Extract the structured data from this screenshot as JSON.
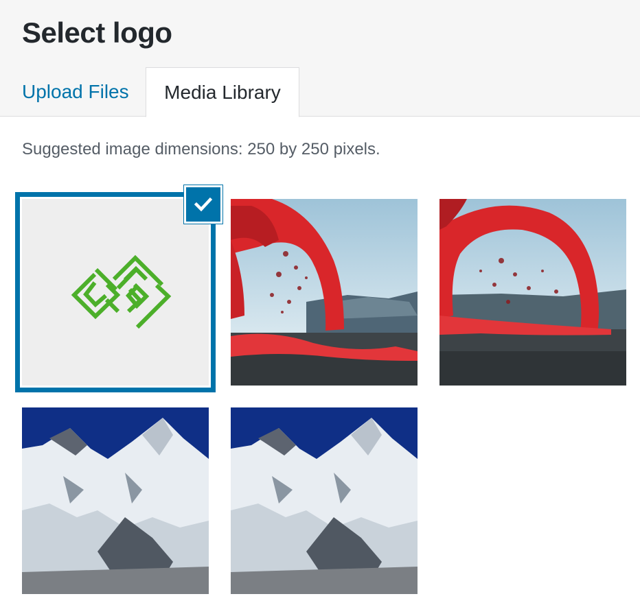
{
  "header": {
    "title": "Select logo",
    "tabs": [
      {
        "label": "Upload Files",
        "active": false
      },
      {
        "label": "Media Library",
        "active": true
      }
    ]
  },
  "library": {
    "hint": "Suggested image dimensions: 250 by 250 pixels.",
    "selected_index": 0,
    "items": [
      {
        "subject": "green-geometric-logo",
        "selected": true
      },
      {
        "subject": "lava-fountain-photo",
        "selected": false
      },
      {
        "subject": "lava-fountain-photo",
        "selected": false
      },
      {
        "subject": "snowy-mountain-photo",
        "selected": false
      },
      {
        "subject": "snowy-mountain-photo",
        "selected": false
      }
    ]
  },
  "colors": {
    "accent": "#0073aa",
    "header_bg": "#f6f6f6",
    "title_text": "#23282d",
    "logo_green": "#4caf2a"
  },
  "icons": {
    "selected_check": "checkmark-icon"
  }
}
